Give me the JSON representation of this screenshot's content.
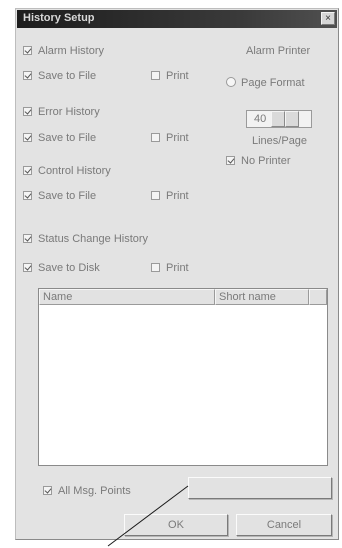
{
  "window": {
    "title": "History Setup",
    "close_glyph": "×"
  },
  "alarm_history": {
    "label": "Alarm History",
    "checked": true
  },
  "alarm_save": {
    "save_label": "Save to File",
    "save_checked": true,
    "print_label": "Print",
    "print_checked": false
  },
  "error_history": {
    "label": "Error History",
    "checked": true
  },
  "error_save": {
    "save_label": "Save to File",
    "save_checked": true,
    "print_label": "Print",
    "print_checked": false
  },
  "control_history": {
    "label": "Control History",
    "checked": true
  },
  "control_save": {
    "save_label": "Save to File",
    "save_checked": true,
    "print_label": "Print",
    "print_checked": false
  },
  "status_history": {
    "label": "Status Change History",
    "checked": true
  },
  "status_save": {
    "save_label": "Save to Disk",
    "save_checked": true,
    "print_label": "Print",
    "print_checked": false
  },
  "alarm_printer": {
    "heading": "Alarm Printer",
    "page_format_label": "Page Format",
    "lines_per_page_value": "40",
    "lines_per_page_label": "Lines/Page",
    "no_printer_label": "No Printer",
    "no_printer_checked": true
  },
  "points_table": {
    "columns": [
      "Name",
      "Short name",
      ""
    ]
  },
  "all_msg_points": {
    "label": "All Msg. Points",
    "checked": true
  },
  "buttons": {
    "ok": "OK",
    "cancel": "Cancel",
    "points_button": ""
  }
}
